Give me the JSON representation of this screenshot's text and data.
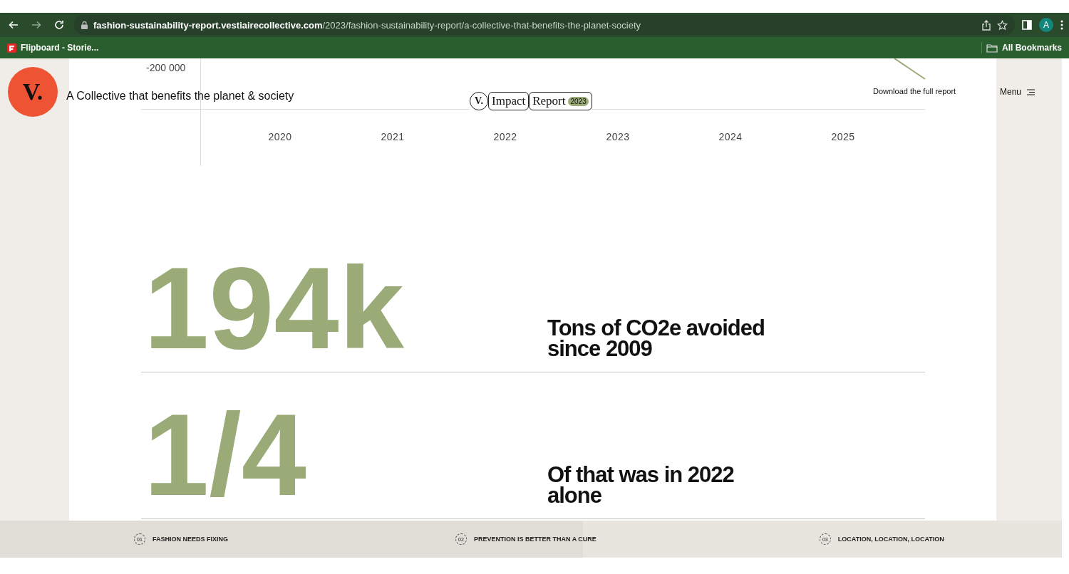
{
  "browser": {
    "url_host": "fashion-sustainability-report.vestiairecollective.com",
    "url_path": "/2023/fashion-sustainability-report/a-collective-that-benefits-the-planet-society",
    "avatar": "A",
    "bookmarks": [
      {
        "label": "Flipboard - Storie..."
      }
    ],
    "all_bookmarks": "All Bookmarks"
  },
  "header": {
    "logo": "V.",
    "title": "A Collective that benefits the planet & society",
    "badge": {
      "logo": "V.",
      "word_1": "Impact",
      "word_2": "Report",
      "year": "2023"
    },
    "download_link": "Download the full report",
    "menu": "Menu"
  },
  "chart": {
    "y_tick": "-200 000",
    "x_labels": [
      "2020",
      "2021",
      "2022",
      "2023",
      "2024",
      "2025"
    ]
  },
  "stats": [
    {
      "value": "194k",
      "label": "Tons of CO2e avoided since 2009"
    },
    {
      "value": "1/4",
      "label": "Of that was in 2022 alone"
    }
  ],
  "footer_nav": [
    {
      "number": "01",
      "label": "FASHION NEEDS FIXING"
    },
    {
      "number": "02",
      "label": "PREVENTION IS BETTER THAN A CURE"
    },
    {
      "number": "03",
      "label": "LOCATION, LOCATION, LOCATION"
    }
  ]
}
